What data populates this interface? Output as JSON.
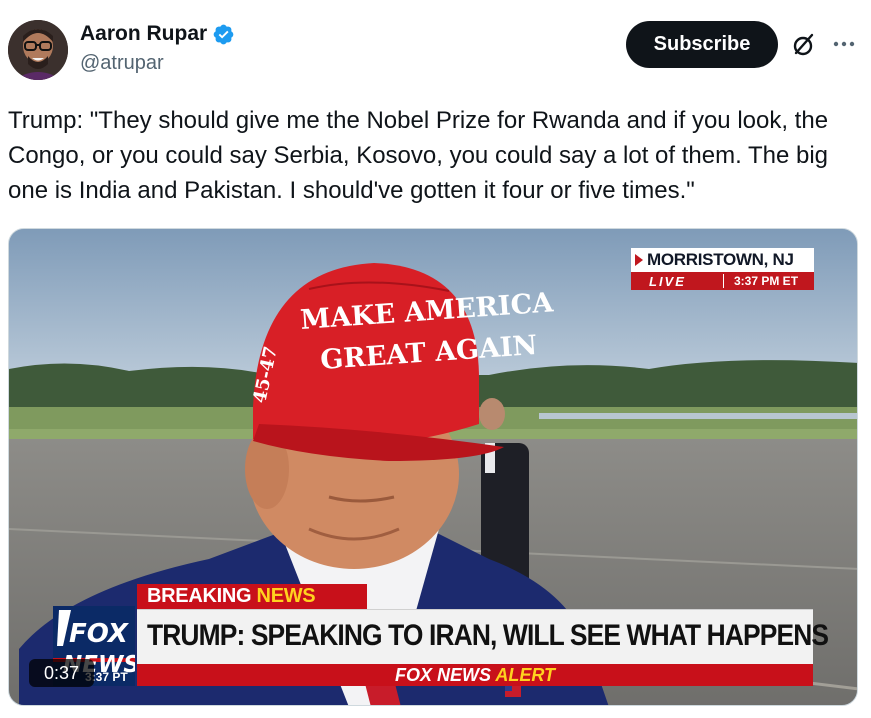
{
  "post": {
    "author": {
      "display_name": "Aaron Rupar",
      "handle": "@atrupar",
      "verified": true,
      "verified_color": "#1d9bf0"
    },
    "subscribe_label": "Subscribe",
    "icons": {
      "grok": "grok-icon",
      "more": "more-icon",
      "verified": "verified-badge-icon"
    },
    "text": "Trump: \"They should give me the Nobel Prize for Rwanda and if you look, the Congo, or you could say Serbia, Kosovo, you could say a lot of them. The big one is India and Pakistan. I should've gotten it four or five times.\""
  },
  "video": {
    "duration": "0:37",
    "location_name": "MORRISTOWN, NJ",
    "live_label": "LIVE",
    "live_time": "3:37 PM ET",
    "hat_text_line1": "MAKE AMERICA",
    "hat_text_line2": "GREAT AGAIN",
    "hat_side_text": "45-47",
    "breaking_word": "BREAKING",
    "news_word": "NEWS",
    "channel_logo_line1": "FOX",
    "channel_logo_line2": "NEWS",
    "logo_time": "3:37 PT",
    "headline": "TRUMP: SPEAKING TO IRAN, WILL SEE WHAT HAPPENS",
    "alert_fox": "FOX NEWS",
    "alert_word": "ALERT",
    "colors": {
      "fox_red": "#c8101a",
      "fox_yellow": "#ffd21f",
      "fox_blue": "#0b2a66",
      "hat_red": "#d81f26"
    }
  }
}
